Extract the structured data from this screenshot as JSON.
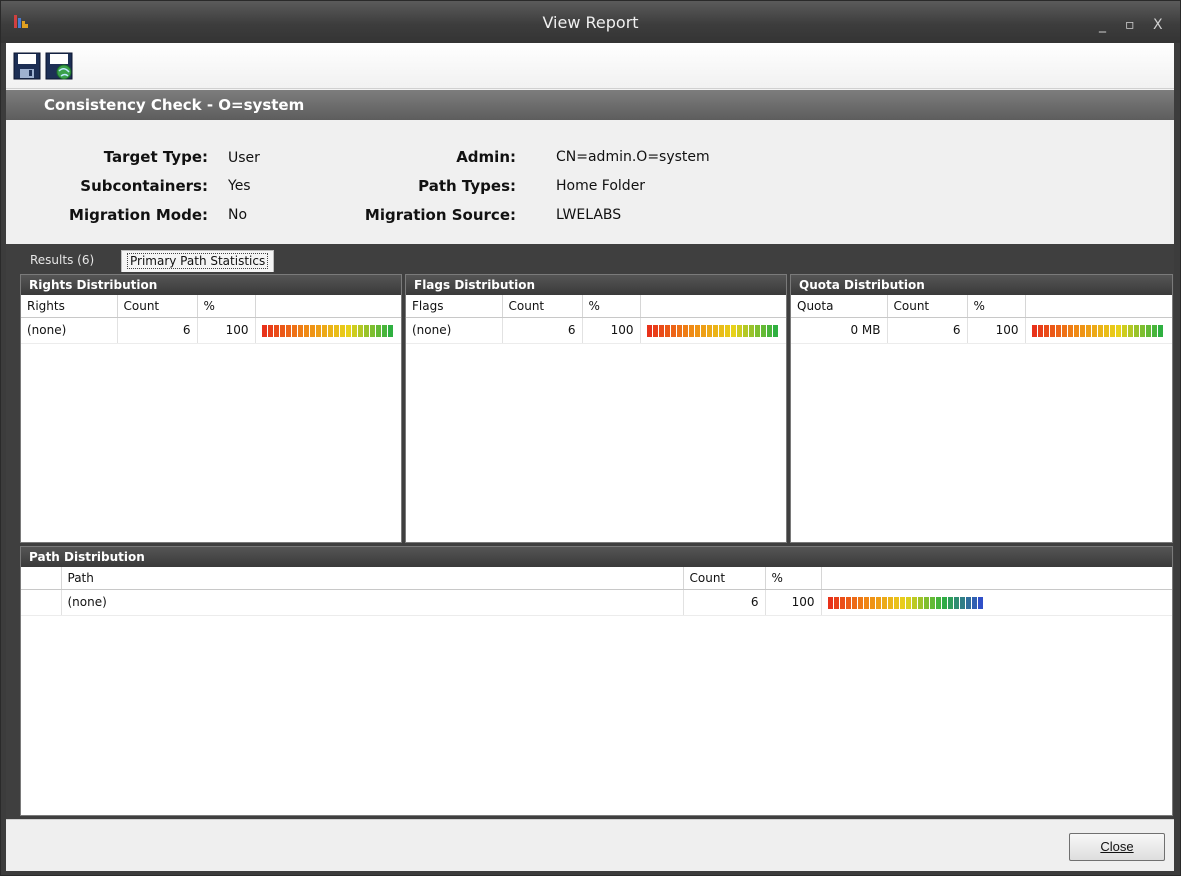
{
  "window": {
    "title": "View Report"
  },
  "report": {
    "title": "Consistency Check - O=system",
    "summary": {
      "target_type_label": "Target Type:",
      "target_type_value": "User",
      "subcontainers_label": "Subcontainers:",
      "subcontainers_value": "Yes",
      "migration_mode_label": "Migration Mode:",
      "migration_mode_value": "No",
      "admin_label": "Admin:",
      "admin_value": "CN=admin.O=system",
      "path_types_label": "Path Types:",
      "path_types_value": "Home Folder",
      "migration_source_label": "Migration Source:",
      "migration_source_value": "LWELABS"
    }
  },
  "tabs": {
    "results": "Results  (6)",
    "primary": "Primary Path Statistics"
  },
  "rights": {
    "title": "Rights Distribution",
    "columns": [
      "Rights",
      "Count",
      "%"
    ],
    "rows": [
      {
        "key": "(none)",
        "count": "6",
        "pct": "100"
      }
    ]
  },
  "flags": {
    "title": "Flags Distribution",
    "columns": [
      "Flags",
      "Count",
      "%"
    ],
    "rows": [
      {
        "key": "(none)",
        "count": "6",
        "pct": "100"
      }
    ]
  },
  "quota": {
    "title": "Quota Distribution",
    "columns": [
      "Quota",
      "Count",
      "%"
    ],
    "rows": [
      {
        "key": "0 MB",
        "count": "6",
        "pct": "100"
      }
    ]
  },
  "path": {
    "title": "Path Distribution",
    "columns": [
      "Path",
      "Count",
      "%"
    ],
    "rows": [
      {
        "key": "(none)",
        "count": "6",
        "pct": "100"
      }
    ]
  },
  "buttons": {
    "close_label": "Close"
  },
  "colors": {
    "bar_red": "#e8321a",
    "bar_orange": "#f08a14",
    "bar_yellow": "#e8d21a",
    "bar_green": "#2fb040",
    "bar_blue": "#2f4fc8"
  }
}
